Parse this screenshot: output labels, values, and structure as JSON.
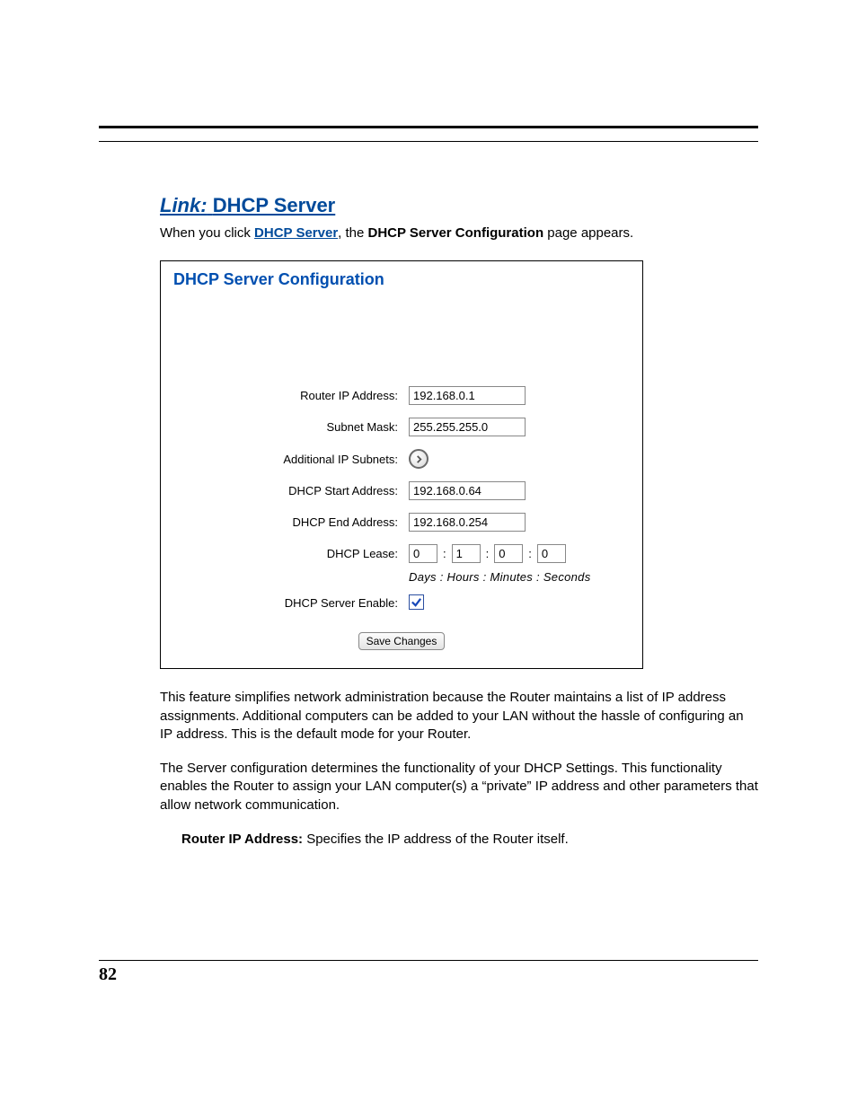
{
  "heading": {
    "prefix": "Link:",
    "title": "DHCP Server"
  },
  "intro": {
    "pre": "When you click ",
    "link": "DHCP Server",
    "mid": ", the ",
    "bold": "DHCP Server Configuration",
    "post": " page appears."
  },
  "panel": {
    "title": "DHCP Server Configuration",
    "rows": {
      "router_ip": {
        "label": "Router IP Address:",
        "value": "192.168.0.1"
      },
      "subnet": {
        "label": "Subnet Mask:",
        "value": "255.255.255.0"
      },
      "addl_sub": {
        "label": "Additional IP Subnets:"
      },
      "dhcp_start": {
        "label": "DHCP Start Address:",
        "value": "192.168.0.64"
      },
      "dhcp_end": {
        "label": "DHCP End Address:",
        "value": "192.168.0.254"
      },
      "lease": {
        "label": "DHCP Lease:",
        "days": "0",
        "hours": "1",
        "minutes": "0",
        "seconds": "0"
      },
      "lease_caption": "Days  :  Hours  :  Minutes  :  Seconds",
      "enable": {
        "label": "DHCP Server Enable:",
        "checked": true
      }
    },
    "save_label": "Save Changes"
  },
  "paragraphs": {
    "p1": "This feature simplifies network administration because the Router maintains a list of IP address assignments. Additional computers can be added to your LAN without the hassle of configuring an IP address. This is the default mode for your Router.",
    "p2": "The Server configuration determines the functionality of your DHCP Settings. This functionality enables the Router to assign your LAN computer(s) a “private” IP address and other parameters that allow network communication.",
    "def_term": "Router IP Address:",
    "def_body": " Specifies the IP address of the Router itself."
  },
  "page_number": "82"
}
